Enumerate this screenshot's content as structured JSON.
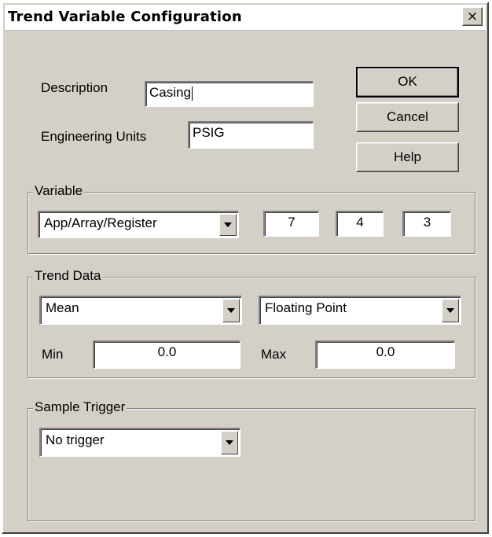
{
  "window": {
    "title": "Trend Variable Configuration",
    "close_glyph": "×"
  },
  "description": {
    "label": "Description",
    "value": "Casing"
  },
  "engineering_units": {
    "label": "Engineering Units",
    "value": "PSIG"
  },
  "buttons": {
    "ok": "OK",
    "cancel": "Cancel",
    "help": "Help"
  },
  "variable": {
    "group_label": "Variable",
    "type": "App/Array/Register",
    "app": "7",
    "array": "4",
    "register": "3"
  },
  "trend_data": {
    "group_label": "Trend Data",
    "statistic": "Mean",
    "format": "Floating Point",
    "min_label": "Min",
    "min_value": "0.0",
    "max_label": "Max",
    "max_value": "0.0"
  },
  "sample_trigger": {
    "group_label": "Sample Trigger",
    "value": "No trigger"
  }
}
